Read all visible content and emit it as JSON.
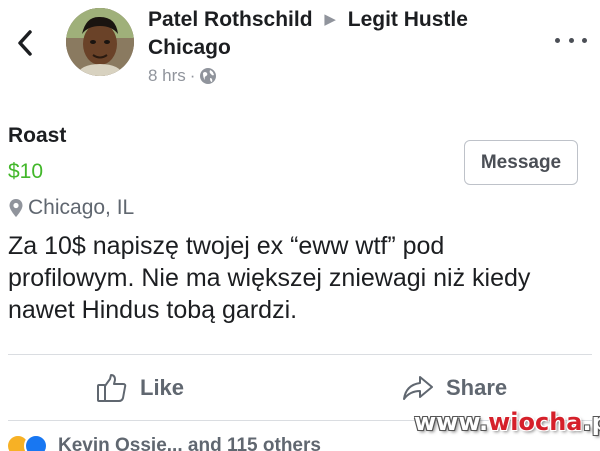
{
  "header": {
    "author": "Patel Rothschild",
    "group": "Legit Hustle",
    "group_location": "Chicago",
    "time": "8 hrs",
    "separator": "·"
  },
  "listing": {
    "title": "Roast",
    "price": "$10",
    "location": "Chicago, IL",
    "message_label": "Message"
  },
  "post": {
    "text": "Za 10$ napiszę twojej ex “eww wtf” pod profilowym. Nie ma większej zniewagi niż kiedy nawet Hindus tobą gardzi."
  },
  "actions": {
    "like_label": "Like",
    "share_label": "Share"
  },
  "reactions": {
    "summary": "Kevin Ossie... and 115 others"
  },
  "watermark": {
    "part1": "www.",
    "part2": "wiocha",
    "part3": ".pl"
  },
  "colors": {
    "price": "#42b72a",
    "text": "#1c1e21",
    "secondary": "#90949c",
    "like_blue": "#1877f2"
  },
  "icons": {
    "back": "chevron-left-icon",
    "more": "ellipsis-icon",
    "privacy": "globe-icon",
    "location": "map-pin-icon",
    "like": "thumbs-up-icon",
    "share": "share-arrow-icon"
  }
}
